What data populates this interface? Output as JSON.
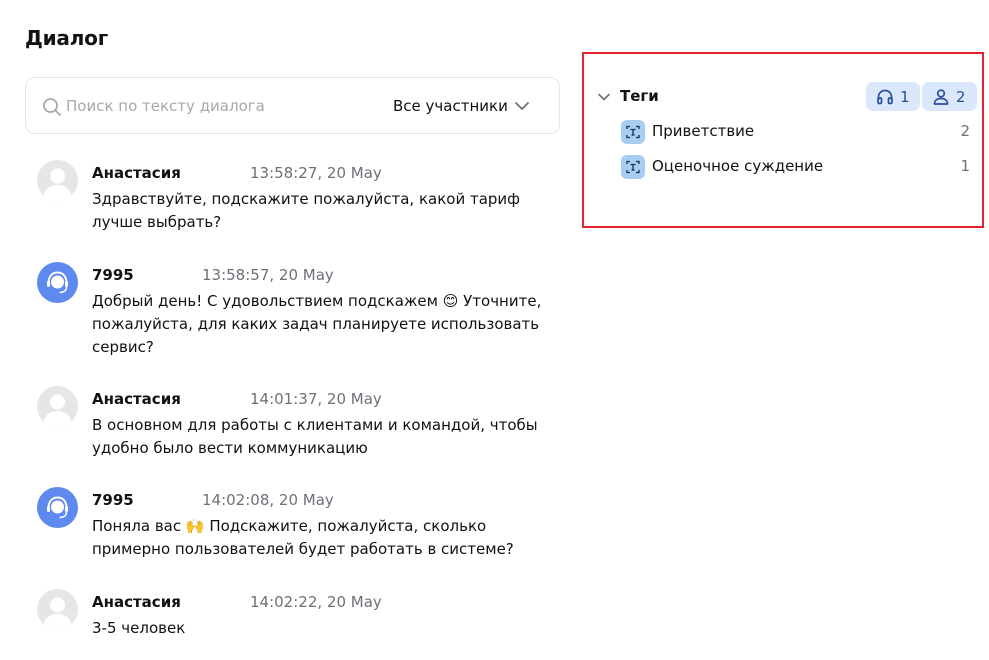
{
  "dialog": {
    "title": "Диалог",
    "search": {
      "placeholder": "Поиск по тексту диалога",
      "icon": "search-icon"
    },
    "filter": {
      "selected": "Все участники",
      "icon": "chevron-down-icon"
    },
    "messages": [
      {
        "author": "Анастасия",
        "role": "client",
        "time": "13:58:27, 20 May",
        "text": "Здравствуйте, подскажите пожалуйста, какой тариф лучше выбрать?"
      },
      {
        "author": "7995",
        "role": "operator",
        "time": "13:58:57, 20 May",
        "text": "Добрый день! С удовольствием подскажем 😊 Уточните, пожалуйста, для каких задач планируете использовать сервис?"
      },
      {
        "author": "Анастасия",
        "role": "client",
        "time": "14:01:37, 20 May",
        "text": "В основном для работы с клиентами и командой, чтобы удобно было вести коммуникацию"
      },
      {
        "author": "7995",
        "role": "operator",
        "time": "14:02:08, 20 May",
        "text": "Поняла вас 🙌 Подскажите, пожалуйста, сколько примерно пользователей будет работать в системе?"
      },
      {
        "author": "Анастасия",
        "role": "client",
        "time": "14:02:22, 20 May",
        "text": "3-5 человек"
      }
    ]
  },
  "tags_panel": {
    "title": "Теги",
    "operator_count": "1",
    "client_count": "2",
    "highlight_color": "#e8222b",
    "tags": [
      {
        "label": "Приветствие",
        "count": "2",
        "icon": "tag-scan-icon"
      },
      {
        "label": "Оценочное суждение",
        "count": "1",
        "icon": "tag-scan-icon"
      }
    ]
  }
}
